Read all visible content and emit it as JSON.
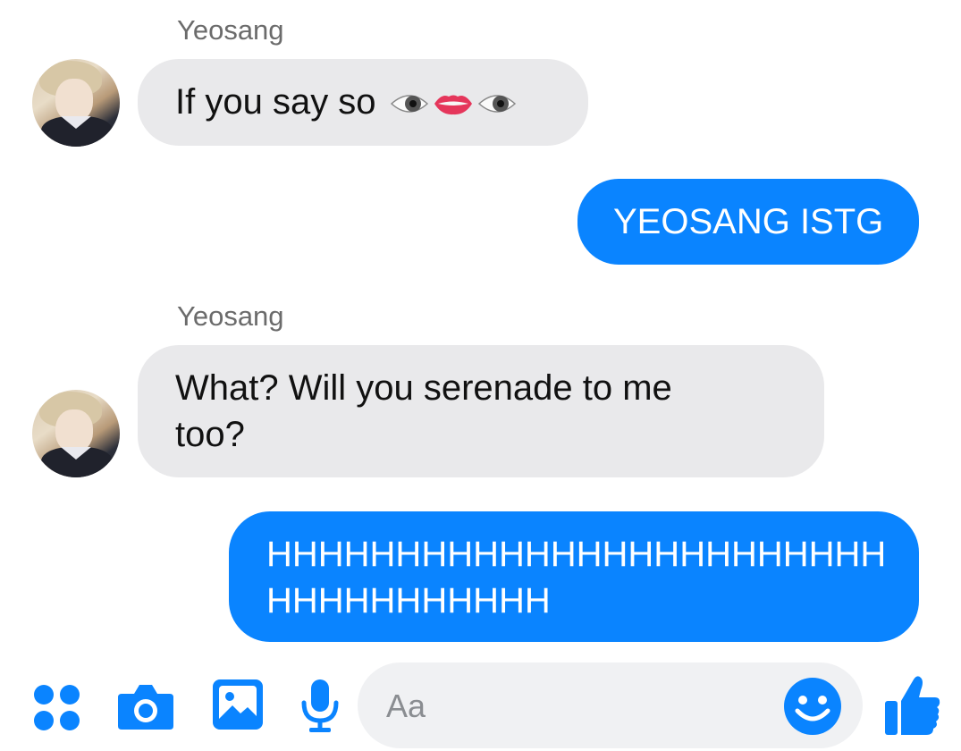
{
  "messages": [
    {
      "type": "incoming",
      "sender": "Yeosang",
      "text": "If you say so",
      "emoji": [
        "eye-icon",
        "lips-icon",
        "eye-icon"
      ]
    },
    {
      "type": "outgoing",
      "text": "YEOSANG ISTG"
    },
    {
      "type": "incoming",
      "sender": "Yeosang",
      "lines": [
        "What? Will you serenade to me",
        "too?"
      ]
    },
    {
      "type": "outgoing",
      "lines": [
        "HHHHHHHHHHHHHHHHHHHHHHHH",
        "HHHHHHHHHHH"
      ]
    }
  ],
  "composer": {
    "placeholder": "Aa",
    "icons": [
      "apps-icon",
      "camera-icon",
      "gallery-icon",
      "microphone-icon",
      "emoji-icon",
      "thumbs-up-icon"
    ]
  },
  "colors": {
    "accent": "#0a84ff",
    "incoming_bubble": "#e9e9eb",
    "muted_text": "#6b6b6b"
  }
}
